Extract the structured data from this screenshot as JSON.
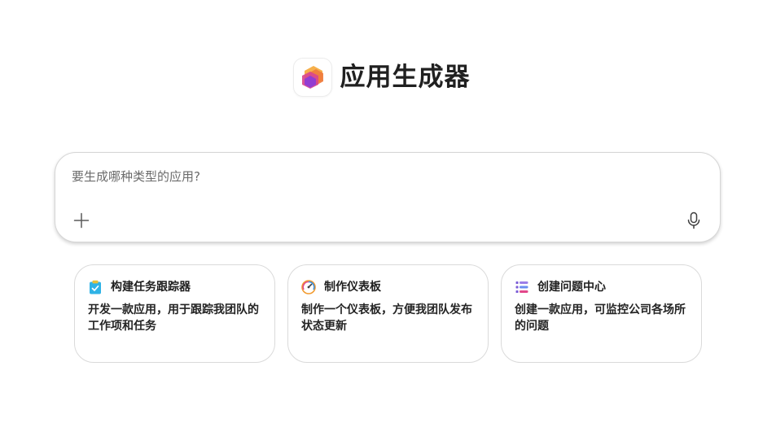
{
  "app": {
    "title": "应用生成器",
    "logo_icon": "hexagon-app-logo-icon"
  },
  "prompt": {
    "placeholder": "要生成哪种类型的应用?",
    "value": "",
    "add_icon": "plus-icon",
    "mic_icon": "microphone-icon"
  },
  "suggestions": [
    {
      "icon": "clipboard-check-icon",
      "title": "构建任务跟踪器",
      "description": "开发一款应用，用于跟踪我团队的工作项和任务"
    },
    {
      "icon": "gauge-dashboard-icon",
      "title": "制作仪表板",
      "description": "制作一个仪表板，方便我团队发布状态更新"
    },
    {
      "icon": "stacked-list-icon",
      "title": "创建问题中心",
      "description": "创建一款应用，可监控公司各场所的问题"
    }
  ],
  "colors": {
    "logo_orange": "#f59a2b",
    "logo_pink": "#e2478a",
    "logo_purple": "#8a3bd9",
    "clipboard_teal": "#2aa8d8",
    "gauge_orange": "#f39c27",
    "list_purple": "#7b5cd6"
  }
}
